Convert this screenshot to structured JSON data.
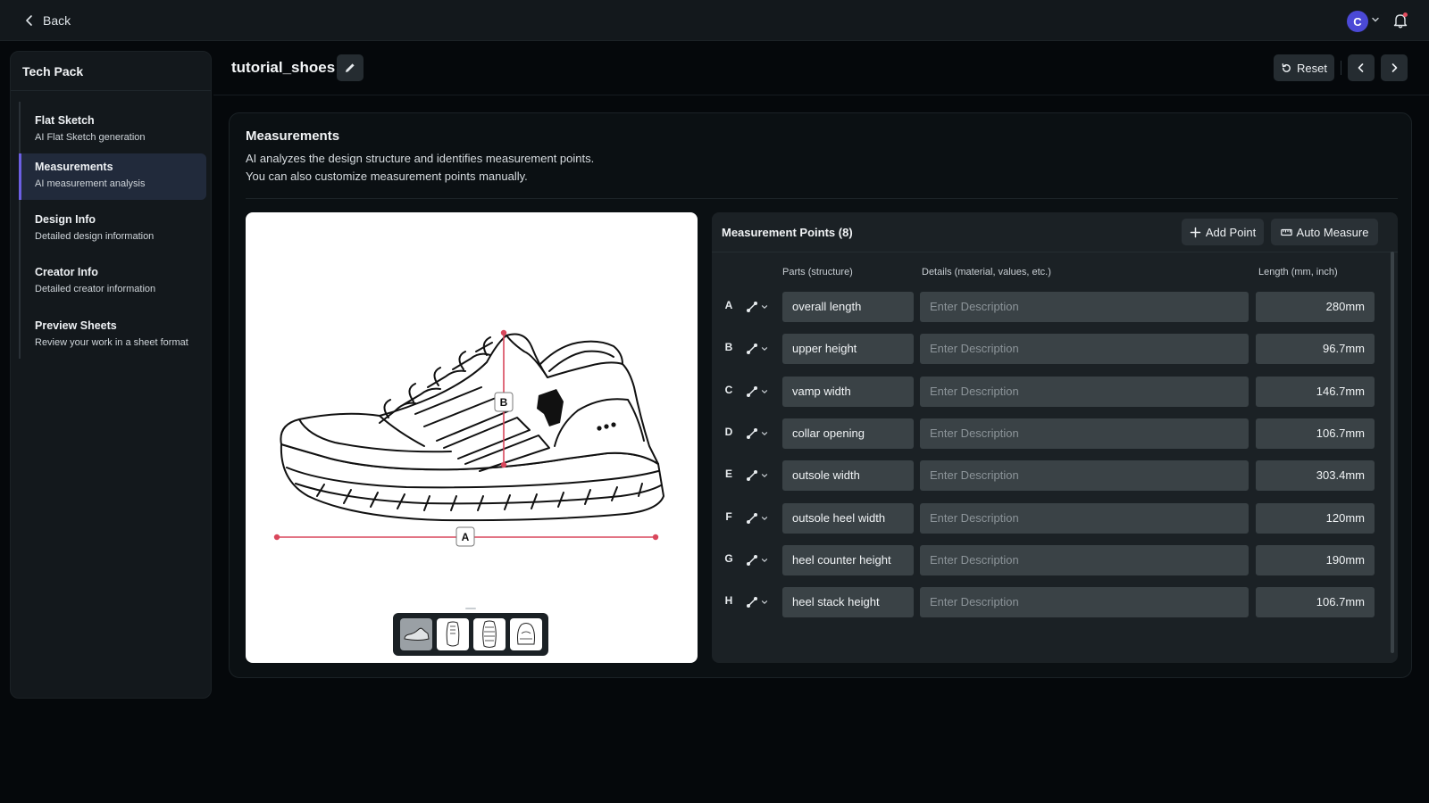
{
  "topbar": {
    "back_label": "Back",
    "avatar_initial": "C"
  },
  "sidebar": {
    "title": "Tech Pack",
    "items": [
      {
        "title": "Flat Sketch",
        "subtitle": "AI Flat Sketch generation",
        "active": false
      },
      {
        "title": "Measurements",
        "subtitle": "AI measurement analysis",
        "active": true
      },
      {
        "title": "Design Info",
        "subtitle": "Detailed design information",
        "active": false
      },
      {
        "title": "Creator Info",
        "subtitle": "Detailed creator information",
        "active": false
      },
      {
        "title": "Preview Sheets",
        "subtitle": "Review your work in a sheet format",
        "active": false
      }
    ]
  },
  "header": {
    "title": "tutorial_shoes",
    "reset_label": "Reset"
  },
  "section": {
    "title": "Measurements",
    "desc_line1": "AI analyzes the design structure and identifies measurement points.",
    "desc_line2": "You can also customize measurement points manually."
  },
  "image": {
    "markers": [
      "A",
      "B"
    ]
  },
  "panel": {
    "title": "Measurement Points (8)",
    "add_point_label": "Add Point",
    "auto_measure_label": "Auto Measure",
    "columns": {
      "parts": "Parts (structure)",
      "details": "Details (material, values, etc.)",
      "length": "Length (mm, inch)"
    },
    "rows": [
      {
        "letter": "A",
        "part": "overall length",
        "placeholder": "Enter Description",
        "length": "280mm"
      },
      {
        "letter": "B",
        "part": "upper height",
        "placeholder": "Enter Description",
        "length": "96.7mm"
      },
      {
        "letter": "C",
        "part": "vamp width",
        "placeholder": "Enter Description",
        "length": "146.7mm"
      },
      {
        "letter": "D",
        "part": "collar opening",
        "placeholder": "Enter Description",
        "length": "106.7mm"
      },
      {
        "letter": "E",
        "part": "outsole width",
        "placeholder": "Enter Description",
        "length": "303.4mm"
      },
      {
        "letter": "F",
        "part": "outsole heel width",
        "placeholder": "Enter Description",
        "length": "120mm"
      },
      {
        "letter": "G",
        "part": "heel counter height",
        "placeholder": "Enter Description",
        "length": "190mm"
      },
      {
        "letter": "H",
        "part": "heel stack height",
        "placeholder": "Enter Description",
        "length": "106.7mm"
      }
    ]
  },
  "colors": {
    "accent": "#6c5fe3",
    "avatar": "#4b49d6",
    "measure_line": "#d9475c"
  }
}
